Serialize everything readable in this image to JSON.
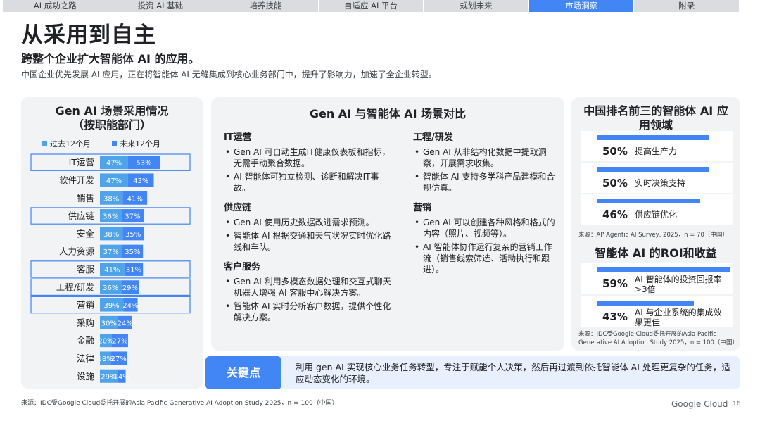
{
  "nav": {
    "tabs": [
      {
        "label": "AI 成功之路",
        "active": false
      },
      {
        "label": "投资 AI 基础",
        "active": false
      },
      {
        "label": "培养技能",
        "active": false
      },
      {
        "label": "自适应 AI 平台",
        "active": false
      },
      {
        "label": "规划未来",
        "active": false
      },
      {
        "label": "市场洞察",
        "active": true
      },
      {
        "label": "附录",
        "active": false
      }
    ]
  },
  "header": {
    "title": "从采用到自主",
    "subtitle": "跨整个企业扩大智能体 AI 的应用。",
    "description": "中国企业优先发展 AI 应用，正在将智能体 AI 无缝集成到核心业务部门中，提升了影响力，加速了全企业转型。"
  },
  "chart_panel": {
    "title_line1": "Gen AI 场景采用情况",
    "title_line2": "（按职能部门）",
    "legend_past": "过去12个月",
    "legend_future": "未来12个月"
  },
  "chart_data": {
    "type": "bar",
    "orientation": "horizontal",
    "stacked": true,
    "title": "Gen AI 场景采用情况（按职能部门）",
    "categories": [
      "IT运营",
      "软件开发",
      "销售",
      "供应链",
      "安全",
      "人力资源",
      "客服",
      "工程/研发",
      "营销",
      "采购",
      "金融",
      "法律",
      "设施"
    ],
    "series": [
      {
        "name": "过去12个月",
        "color": "#4fa3e8",
        "values": [
          47,
          47,
          38,
          36,
          38,
          37,
          41,
          36,
          39,
          30,
          20,
          18,
          29
        ]
      },
      {
        "name": "未来12个月",
        "color": "#4285f4",
        "values": [
          53,
          43,
          41,
          37,
          35,
          35,
          31,
          29,
          24,
          24,
          27,
          27,
          14
        ]
      }
    ],
    "highlighted": [
      "IT运营",
      "供应链",
      "客服",
      "工程/研发",
      "营销"
    ],
    "unit": "%",
    "legend_position": "top"
  },
  "comparison": {
    "title": "Gen AI 与智能体 AI 场景对比",
    "left_sections": [
      {
        "heading": "IT运营",
        "bullets": [
          "Gen AI 可自动生成IT健康仪表板和指标，无需手动聚合数据。",
          "AI 智能体可独立检测、诊断和解决IT事故。"
        ]
      },
      {
        "heading": "供应链",
        "bullets": [
          "Gen AI 使用历史数据改进需求预测。",
          "智能体 AI 根据交通和天气状况实时优化路线和车队。"
        ]
      },
      {
        "heading": "客户服务",
        "bullets": [
          "Gen AI 利用多模态数据处理和交互式聊天机器人增强 AI 客服中心解决方案。",
          "智能体 AI 实时分析客户数据，提供个性化解决方案。"
        ]
      }
    ],
    "right_sections": [
      {
        "heading": "工程/研发",
        "bullets": [
          "Gen AI 从非结构化数据中提取洞察，开展需求收集。",
          "智能体 AI 支持多学科产品建模和合规仿真。"
        ]
      },
      {
        "heading": "营销",
        "bullets": [
          "Gen AI 可以创建各种风格和格式的内容（照片、视频等）。",
          "AI 智能体协作运行复杂的营销工作流（销售线索筛选、活动执行和跟进）。"
        ]
      }
    ]
  },
  "top3": {
    "title_line1": "中国排名前三的智能体 AI 应",
    "title_line2": "用领域",
    "stats": [
      {
        "value": "50%",
        "label": "提高生产力",
        "fraction": 0.5
      },
      {
        "value": "50%",
        "label": "实时决策支持",
        "fraction": 0.5
      },
      {
        "value": "46%",
        "label": "供应链优化",
        "fraction": 0.46
      }
    ],
    "source": "来源：AP Agentic AI Survey, 2025，n = 70（中国）"
  },
  "roi": {
    "title": "智能体 AI 的ROI和收益",
    "stats": [
      {
        "value": "59%",
        "label": "AI 智能体的投资回报率>3倍",
        "fraction": 0.59
      },
      {
        "value": "43%",
        "label": "AI 与企业系统的集成效果更佳",
        "fraction": 0.43
      }
    ],
    "source_line1": "来源：IDC受Google Cloud委托开展的Asia Pacific",
    "source_line2": "Generative AI Adoption Study 2025，n = 100（中国）"
  },
  "key_point": {
    "label": "关键点",
    "text": "利用 gen AI 实现核心业务任务转型，专注于赋能个人决策，然后再过渡到依托智能体 AI 处理更复杂的任务，适应动态变化的环境。"
  },
  "footer": {
    "source": "来源：IDC受Google Cloud委托开展的Asia Pacific Generative AI Adoption Study 2025，n = 100（中国）",
    "logo": "Google Cloud",
    "page_number": "16"
  }
}
